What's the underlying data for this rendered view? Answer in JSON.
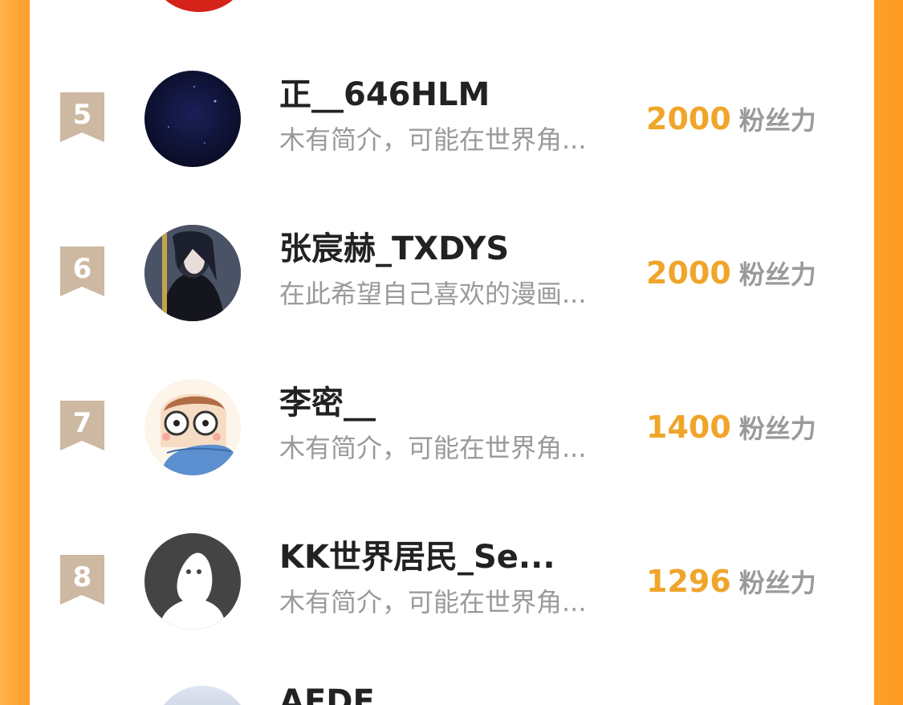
{
  "rows": [
    {
      "rank": "5",
      "name": "正__646HLM",
      "bio": "木有简介，可能在世界角...",
      "score": "2000",
      "unit": "粉丝力",
      "avatar": "night-sky-avatar"
    },
    {
      "rank": "6",
      "name": "张宸赫_TXDYS",
      "bio": "在此希望自己喜欢的漫画...",
      "score": "2000",
      "unit": "粉丝力",
      "avatar": "anime-character-avatar"
    },
    {
      "rank": "7",
      "name": "李密__",
      "bio": "木有简介，可能在世界角...",
      "score": "1400",
      "unit": "粉丝力",
      "avatar": "cartoon-face-avatar"
    },
    {
      "rank": "8",
      "name": "KK世界居民_Se...",
      "bio": "木有简介，可能在世界角...",
      "score": "1296",
      "unit": "粉丝力",
      "avatar": "default-user-avatar"
    }
  ],
  "partial_bottom_name": "AFDE",
  "colors": {
    "accent": "#f0a52a",
    "frame": "#ff9f2b",
    "rank_flag": "#cdb8a2",
    "text": "#222222",
    "muted": "#9a9a9a"
  }
}
